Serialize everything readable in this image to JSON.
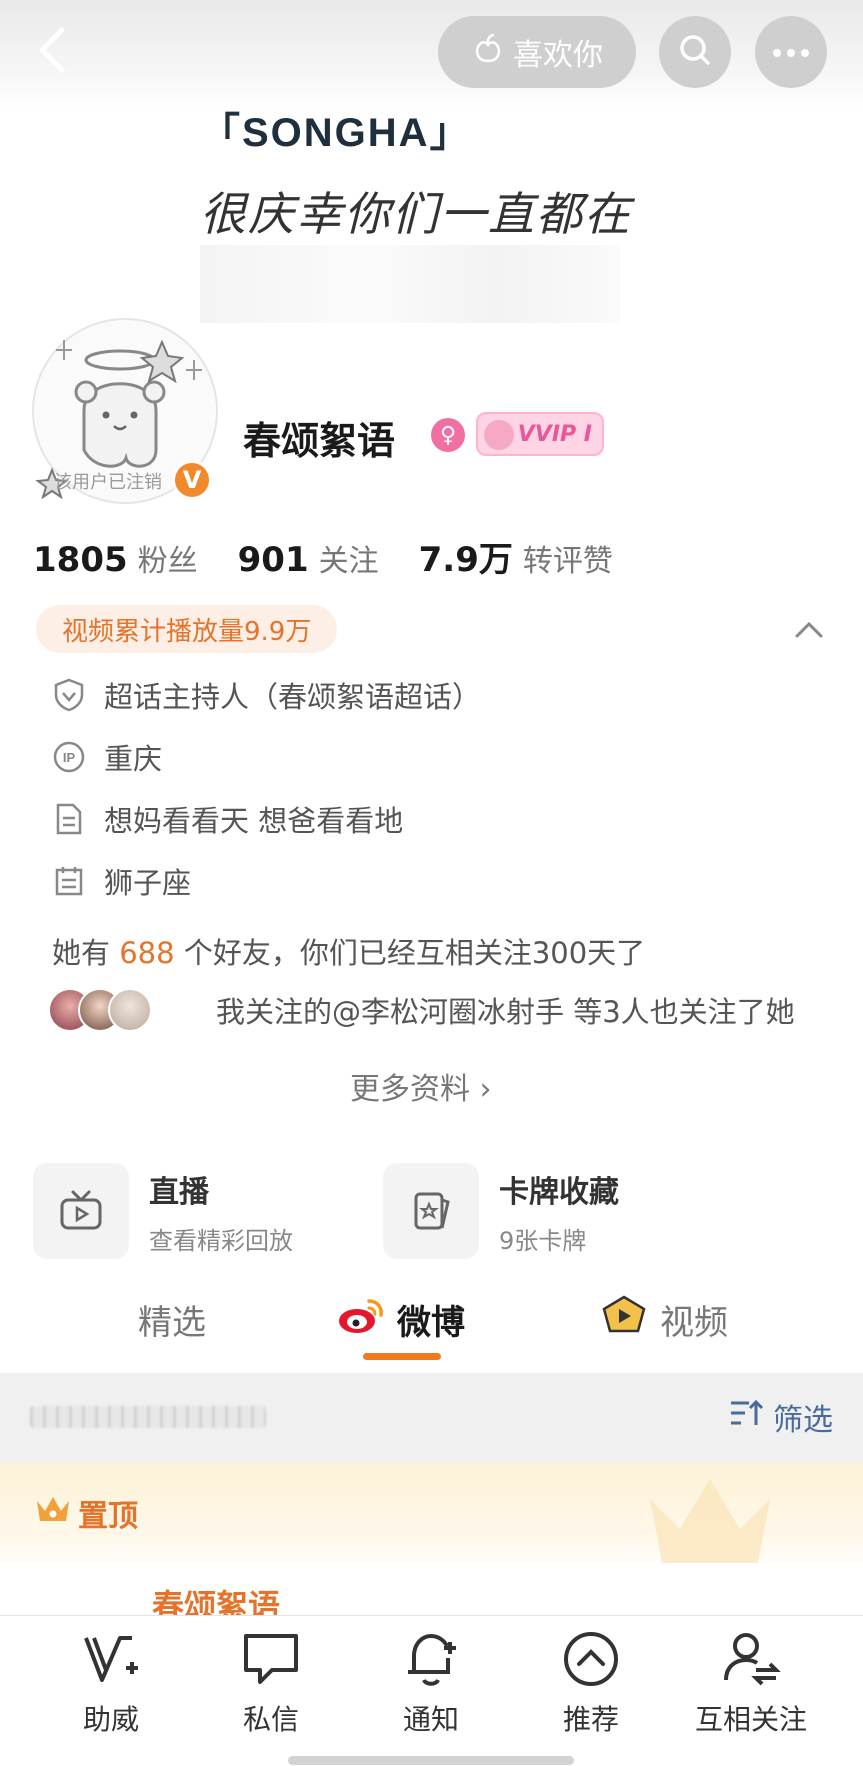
{
  "topbar": {
    "like_label": "喜欢你"
  },
  "cover": {
    "title": "「SONGHA」",
    "handwriting": "很庆幸你们一直都在"
  },
  "profile": {
    "avatar_caption": "该用户已注销",
    "verified_mark": "V",
    "name": "春颂絮语",
    "gender_mark": "♀",
    "vip_label": "VVIP I"
  },
  "stats": [
    {
      "num": "1805",
      "label": "粉丝"
    },
    {
      "num": "901",
      "label": "关注"
    },
    {
      "num": "7.9万",
      "label": "转评赞"
    }
  ],
  "play_badge": "视频累计播放量9.9万",
  "info": {
    "super_topic": "超话主持人（春颂絮语超话）",
    "ip_location": "重庆",
    "bio": "想妈看看天 想爸看看地",
    "zodiac": "狮子座",
    "friends_prefix": "她有",
    "friends_count": "688",
    "friends_suffix": "个好友，你们已经互相关注300天了",
    "mutual_text": "我关注的@李松河圈冰射手 等3人也关注了她",
    "more_label": "更多资料 ›"
  },
  "cards": [
    {
      "title": "直播",
      "sub": "查看精彩回放"
    },
    {
      "title": "卡牌收藏",
      "sub": "9张卡牌"
    }
  ],
  "tabs": [
    {
      "label": "精选"
    },
    {
      "label": "微博"
    },
    {
      "label": "视频"
    }
  ],
  "filter_label": "筛选",
  "pinned_label": "置顶",
  "post_author": "春颂絮语",
  "bottom_nav": [
    {
      "label": "助威"
    },
    {
      "label": "私信"
    },
    {
      "label": "通知"
    },
    {
      "label": "推荐"
    },
    {
      "label": "互相关注"
    }
  ],
  "colors": {
    "accent": "#e5742a",
    "link": "#4a6a9c",
    "vip_pink": "#e9579b"
  }
}
